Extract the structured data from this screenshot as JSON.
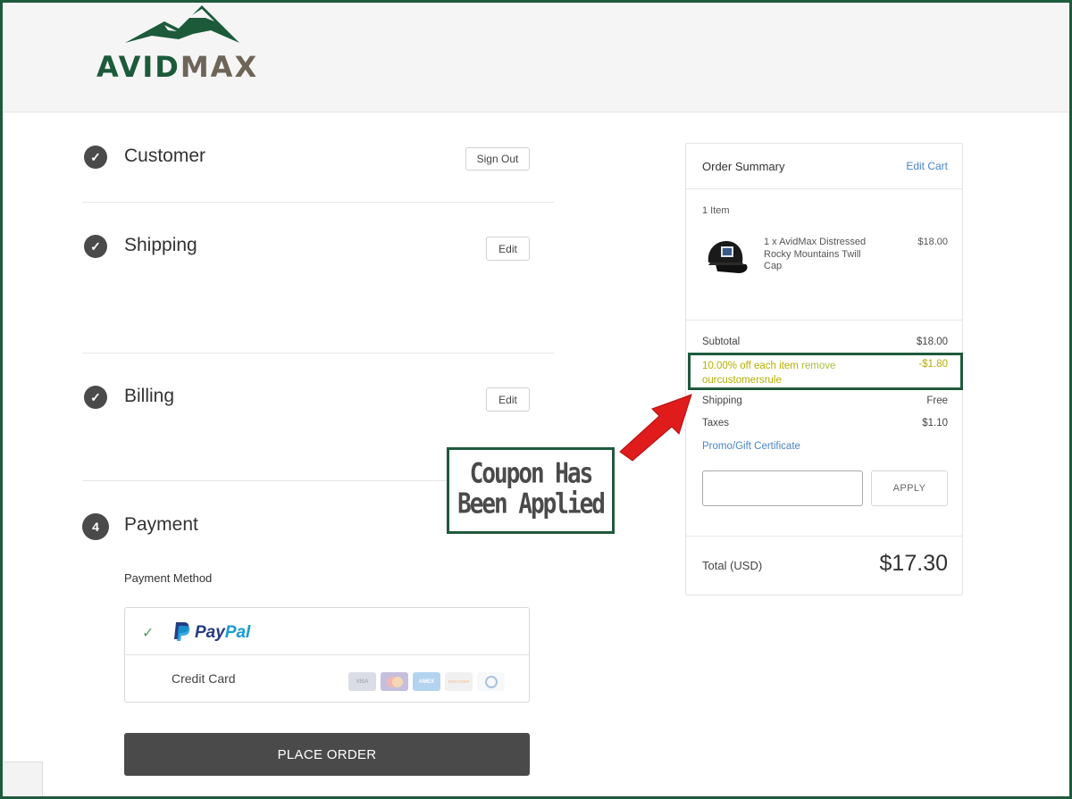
{
  "brand": {
    "name_part1": "AVID",
    "name_part2": "MAX",
    "green": "#1c5a3a",
    "taupe": "#6e6458"
  },
  "steps": {
    "customer": {
      "title": "Customer",
      "action": "Sign Out"
    },
    "shipping": {
      "title": "Shipping",
      "action": "Edit"
    },
    "billing": {
      "title": "Billing",
      "action": "Edit"
    },
    "payment": {
      "number": "4",
      "title": "Payment"
    }
  },
  "payment": {
    "method_label": "Payment Method",
    "paypal_label": "PayPal",
    "credit_card_label": "Credit Card",
    "cards": [
      "VISA",
      "MC",
      "AMEX",
      "DISCOVER",
      "DINERS"
    ],
    "place_order": "PLACE ORDER"
  },
  "summary": {
    "title": "Order Summary",
    "edit_cart": "Edit Cart",
    "item_count": "1 Item",
    "item": {
      "name": "1 x AvidMax Distressed Rocky Mountains Twill Cap",
      "price": "$18.00"
    },
    "subtotal_label": "Subtotal",
    "subtotal": "$18.00",
    "coupon_label": "10.00% off each item",
    "coupon_remove": "remove",
    "coupon_code": "ourcustomersrule",
    "coupon_amount": "-$1.80",
    "shipping_label": "Shipping",
    "shipping": "Free",
    "taxes_label": "Taxes",
    "taxes": "$1.10",
    "promo_label": "Promo/Gift Certificate",
    "apply": "APPLY",
    "total_label": "Total (USD)",
    "total": "$17.30"
  },
  "annotation": {
    "line1": "Coupon Has",
    "line2": "Been Applied"
  }
}
